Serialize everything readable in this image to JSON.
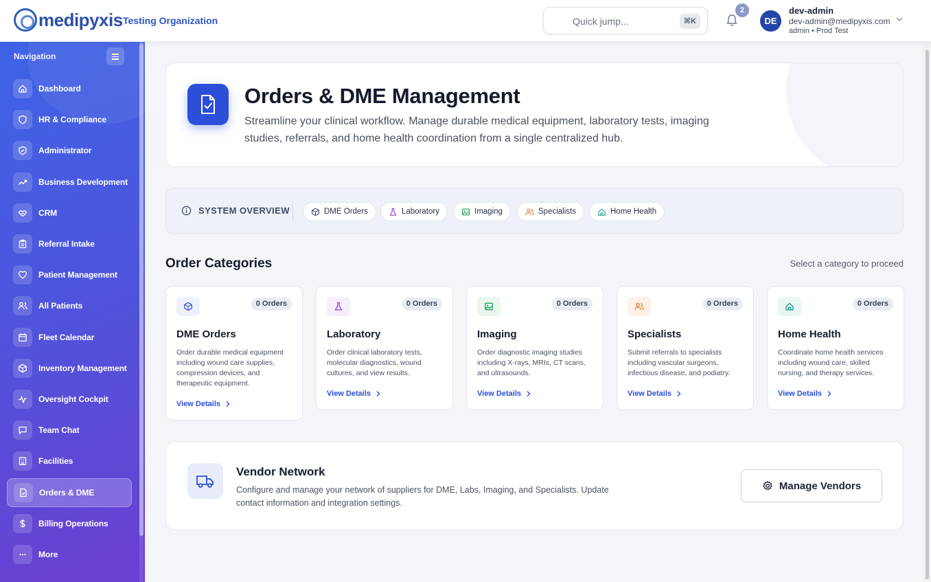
{
  "header": {
    "logo_text": "medipyxis",
    "org_name": "Testing Organization",
    "quick_jump": {
      "placeholder": "Quick jump...",
      "shortcut": "⌘K"
    },
    "notifications_count": "2",
    "user": {
      "initials": "DE",
      "name": "dev-admin",
      "email": "dev-admin@medipyxis.com",
      "role": "admin • Prod Test"
    }
  },
  "sidebar": {
    "title": "Navigation",
    "items": [
      {
        "label": "Dashboard",
        "icon": "home-icon"
      },
      {
        "label": "HR & Compliance",
        "icon": "shield-icon"
      },
      {
        "label": "Administrator",
        "icon": "shield-check-icon"
      },
      {
        "label": "Business Development",
        "icon": "trending-up-icon"
      },
      {
        "label": "CRM",
        "icon": "handshake-icon"
      },
      {
        "label": "Referral Intake",
        "icon": "clipboard-icon"
      },
      {
        "label": "Patient Management",
        "icon": "heart-icon"
      },
      {
        "label": "All Patients",
        "icon": "users-icon"
      },
      {
        "label": "Fleet Calendar",
        "icon": "calendar-icon"
      },
      {
        "label": "Inventory Management",
        "icon": "package-icon"
      },
      {
        "label": "Oversight Cockpit",
        "icon": "activity-icon"
      },
      {
        "label": "Team Chat",
        "icon": "chat-icon"
      },
      {
        "label": "Facilities",
        "icon": "building-icon"
      },
      {
        "label": "Orders & DME",
        "icon": "file-check-icon",
        "active": true
      },
      {
        "label": "Billing Operations",
        "icon": "dollar-icon"
      },
      {
        "label": "More",
        "icon": "more-icon"
      }
    ]
  },
  "hero": {
    "title": "Orders & DME Management",
    "description": "Streamline your clinical workflow. Manage durable medical equipment, laboratory tests, imaging studies, referrals, and home health coordination from a single centralized hub."
  },
  "overview": {
    "label": "SYSTEM OVERVIEW",
    "chips": [
      "DME Orders",
      "Laboratory",
      "Imaging",
      "Specialists",
      "Home Health"
    ]
  },
  "categories": {
    "title": "Order Categories",
    "hint": "Select a category to proceed",
    "cards": [
      {
        "title": "DME Orders",
        "badge": "0 Orders",
        "description": "Order durable medical equipment including wound care supplies, compression devices, and therapeutic equipment.",
        "link": "View Details",
        "accent": "#3b5bdb",
        "icon_bg": "#eef1fb"
      },
      {
        "title": "Laboratory",
        "badge": "0 Orders",
        "description": "Order clinical laboratory tests, molecular diagnostics, wound cultures, and view results.",
        "link": "View Details",
        "accent": "#9b3fd1",
        "icon_bg": "#f5eefb"
      },
      {
        "title": "Imaging",
        "badge": "0 Orders",
        "description": "Order diagnostic imaging studies including X-rays, MRIs, CT scans, and ultrasounds.",
        "link": "View Details",
        "accent": "#1f9d55",
        "icon_bg": "#eaf7ef"
      },
      {
        "title": "Specialists",
        "badge": "0 Orders",
        "description": "Submit referrals to specialists including vascular surgeons, infectious disease, and podiatry.",
        "link": "View Details",
        "accent": "#e8772e",
        "icon_bg": "#fdf1e8"
      },
      {
        "title": "Home Health",
        "badge": "0 Orders",
        "description": "Coordinate home health services including wound care, skilled nursing, and therapy services.",
        "link": "View Details",
        "accent": "#179a8a",
        "icon_bg": "#e8f6f4"
      }
    ]
  },
  "vendor": {
    "title": "Vendor Network",
    "description": "Configure and manage your network of suppliers for DME, Labs, Imaging, and Specialists. Update contact information and integration settings.",
    "button": "Manage Vendors"
  }
}
